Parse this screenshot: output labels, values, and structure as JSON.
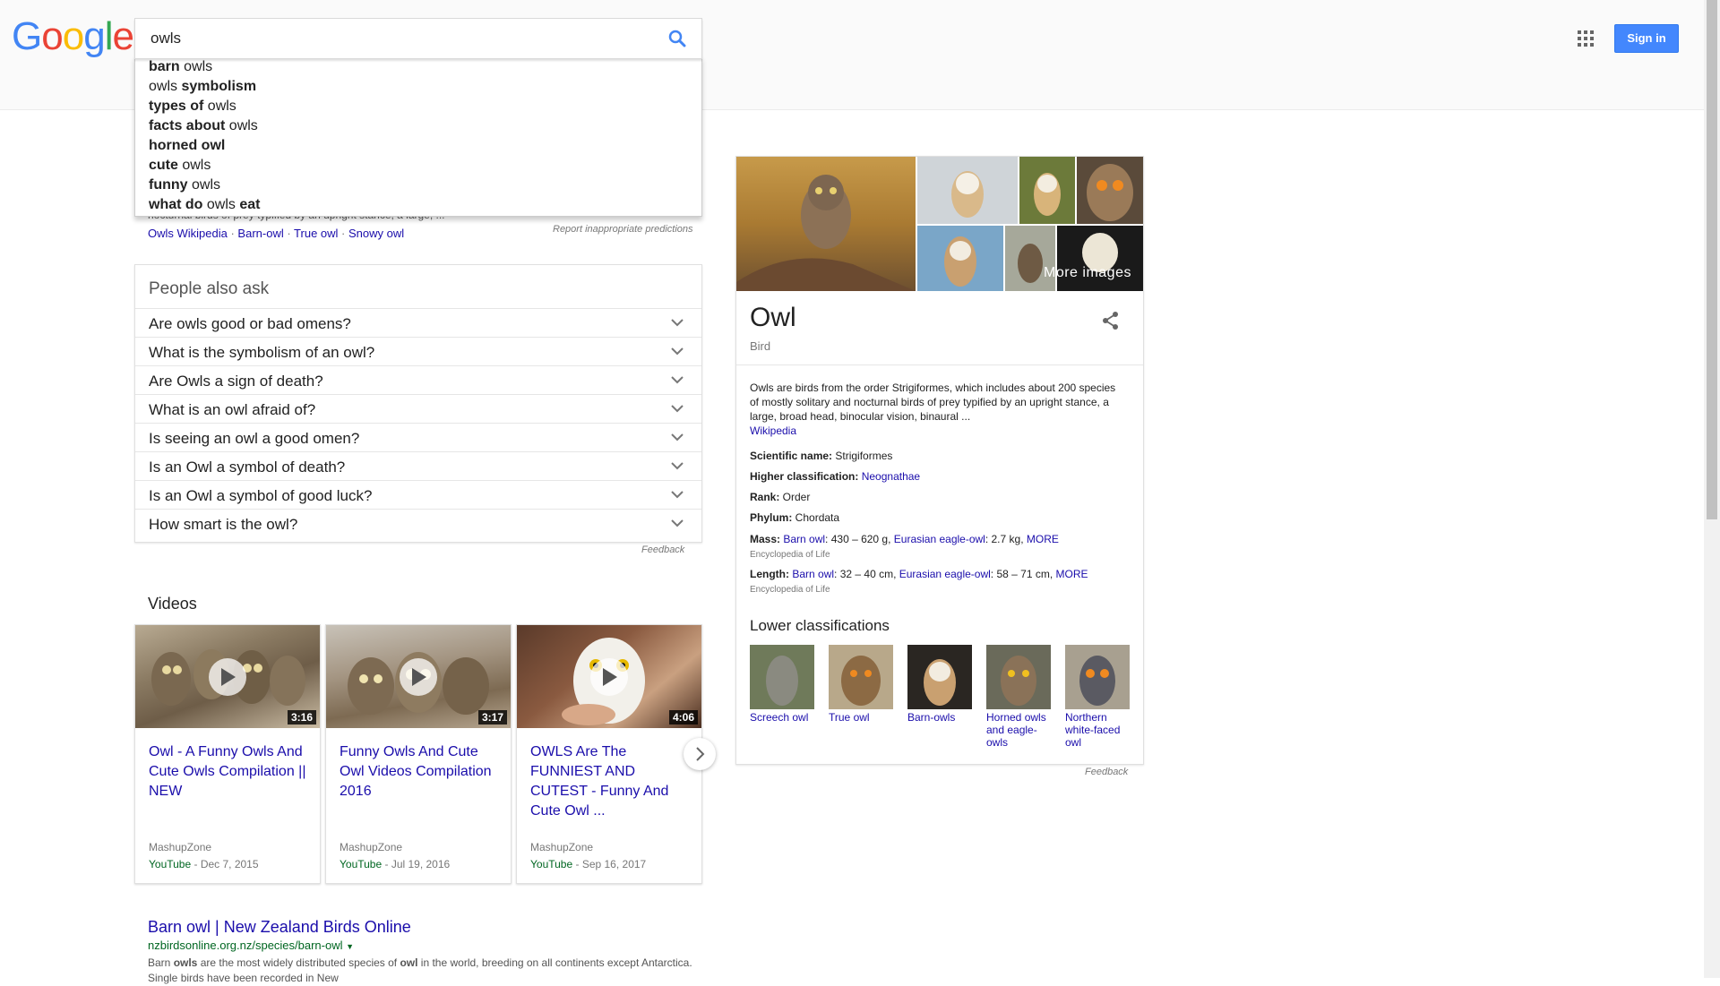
{
  "logo": {
    "text": [
      "G",
      "o",
      "o",
      "g",
      "l",
      "e"
    ],
    "colors": [
      "#4285f4",
      "#ea4335",
      "#fbbc05",
      "#4285f4",
      "#34a853",
      "#ea4335"
    ]
  },
  "search": {
    "value": "owls"
  },
  "header": {
    "signin_label": "Sign in",
    "accent": "#4387fd"
  },
  "suggestions": [
    {
      "bold1": "barn",
      "normal": " owls",
      "bold2": ""
    },
    {
      "bold1": "",
      "normal": "owls ",
      "bold2": "symbolism"
    },
    {
      "bold1": "types of",
      "normal": " owls",
      "bold2": ""
    },
    {
      "bold1": "facts about",
      "normal": " owls",
      "bold2": ""
    },
    {
      "bold1": "horned owl",
      "normal": "",
      "bold2": ""
    },
    {
      "bold1": "cute",
      "normal": " owls",
      "bold2": ""
    },
    {
      "bold1": "funny",
      "normal": " owls",
      "bold2": ""
    },
    {
      "bold1": "what do",
      "normal": " owls ",
      "bold2": "eat"
    }
  ],
  "partial_snippet": "nocturnal birds of prey typified by an upright stance, a large, ...",
  "wiki_links": [
    "Owls Wikipedia",
    "Barn-owl",
    "True owl",
    "Snowy owl"
  ],
  "report_label": "Report inappropriate predictions",
  "paa": {
    "title": "People also ask",
    "questions": [
      "Are owls good or bad omens?",
      "What is the symbolism of an owl?",
      "Are Owls a sign of death?",
      "What is an owl afraid of?",
      "Is seeing an owl a good omen?",
      "Is an Owl a symbol of death?",
      "Is an Owl a symbol of good luck?",
      "How smart is the owl?"
    ],
    "feedback": "Feedback"
  },
  "videos": {
    "title": "Videos",
    "items": [
      {
        "title": "Owl - A Funny Owls And Cute Owls Compilation || NEW",
        "duration": "3:16",
        "channel": "MashupZone",
        "source": "YouTube",
        "date": " - Dec 7, 2015"
      },
      {
        "title": "Funny Owls And Cute Owl Videos Compilation 2016",
        "duration": "3:17",
        "channel": "MashupZone",
        "source": "YouTube",
        "date": " - Jul 19, 2016"
      },
      {
        "title": "OWLS Are The FUNNIEST AND CUTEST - Funny And Cute Owl ...",
        "duration": "4:06",
        "channel": "MashupZone",
        "source": "YouTube",
        "date": " - Sep 16, 2017"
      }
    ]
  },
  "result": {
    "title": "Barn owl | New Zealand Birds Online",
    "url": "nzbirdsonline.org.nz/species/barn-owl",
    "snippet_a": "Barn ",
    "snippet_b": "owls",
    "snippet_c": " are the most widely distributed species of ",
    "snippet_d": "owl",
    "snippet_e": " in the world, breeding on all continents except Antarctica. Single birds have been recorded in New"
  },
  "knowledge": {
    "more_images": "More images",
    "title": "Owl",
    "subtitle": "Bird",
    "description": "Owls are birds from the order Strigiformes, which includes about 200 species of mostly solitary and nocturnal birds of prey typified by an upright stance, a large, broad head, binocular vision, binaural ...",
    "description_link": "Wikipedia",
    "facts": {
      "sci_label": "Scientific name:",
      "sci_value": " Strigiformes",
      "higher_label": "Higher classification:",
      "higher_value": "Neognathae",
      "rank_label": "Rank:",
      "rank_value": " Order",
      "phylum_label": "Phylum:",
      "phylum_value": " Chordata",
      "mass_label": "Mass:",
      "mass_link1": "Barn owl",
      "mass_text1": ": 430 – 620 g, ",
      "mass_link2": "Eurasian eagle-owl",
      "mass_text2": ": 2.7 kg, ",
      "mass_more": "MORE",
      "mass_src": "Encyclopedia of Life",
      "length_label": "Length:",
      "length_link1": "Barn owl",
      "length_text1": ": 32 – 40 cm, ",
      "length_link2": "Eurasian eagle-owl",
      "length_text2": ": 58 – 71 cm, ",
      "length_more": "MORE",
      "length_src": "Encyclopedia of Life"
    },
    "lower_title": "Lower classifications",
    "lower": [
      "Screech owl",
      "True owl",
      "Barn-owls",
      "Horned owls and eagle-owls",
      "Northern white-faced owl"
    ],
    "feedback": "Feedback"
  }
}
